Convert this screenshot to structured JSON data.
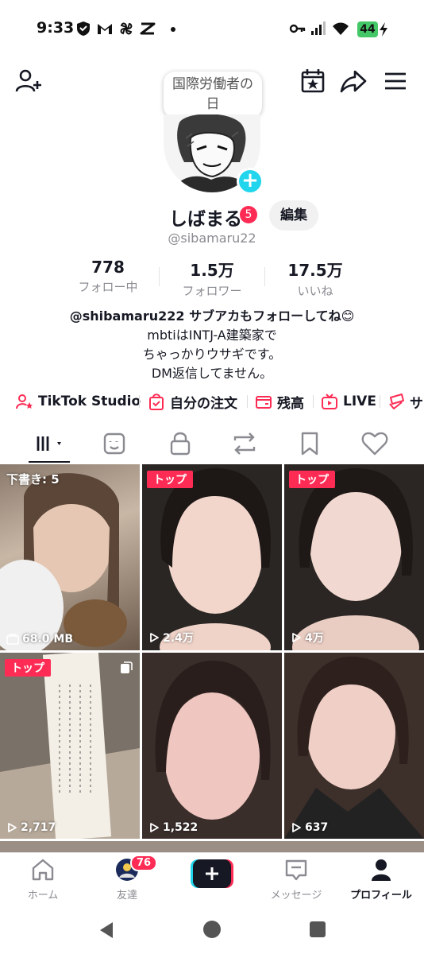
{
  "status_bar": {
    "time": "9:33",
    "battery": "44"
  },
  "header": {
    "event_bubble": "国際労働者の日"
  },
  "profile": {
    "username": "しばまる",
    "badge_count": "5",
    "edit_label": "編集",
    "handle": "@sibamaru22",
    "stats": [
      {
        "value": "778",
        "label": "フォロー中"
      },
      {
        "value": "1.5万",
        "label": "フォロワー"
      },
      {
        "value": "17.5万",
        "label": "いいね"
      }
    ],
    "bio_lines": [
      "@shibamaru222  サブアカもフォローしてね😊",
      "mbtiはINTJ-A建築家で",
      "ちゃっかりウサギです。",
      "DM返信してません。"
    ]
  },
  "shortcuts": [
    {
      "label": "TikTok Studio",
      "icon": "person-star-icon"
    },
    {
      "label": "自分の注文",
      "icon": "bag-check-icon"
    },
    {
      "label": "残高",
      "icon": "wallet-icon"
    },
    {
      "label": "LIVE",
      "icon": "live-tv-icon"
    },
    {
      "label": "サ",
      "icon": "gift-icon"
    }
  ],
  "grid": [
    {
      "badge": "",
      "draft": "下書き: 5",
      "meta": "68.0 MB",
      "meta_icon": "storage-icon"
    },
    {
      "badge": "トップ",
      "draft": "",
      "meta": "2.4万",
      "meta_icon": "play-icon"
    },
    {
      "badge": "トップ",
      "draft": "",
      "meta": "4万",
      "meta_icon": "play-icon"
    },
    {
      "badge": "トップ",
      "draft": "",
      "meta": "2,717",
      "meta_icon": "play-icon"
    },
    {
      "badge": "",
      "draft": "",
      "meta": "1,522",
      "meta_icon": "play-icon"
    },
    {
      "badge": "",
      "draft": "",
      "meta": "637",
      "meta_icon": "play-icon"
    }
  ],
  "bottom_nav": {
    "home": "ホーム",
    "friends": "友達",
    "friends_badge": "76",
    "inbox": "メッセージ",
    "profile": "プロフィール"
  },
  "colors": {
    "accent": "#fe2c55",
    "cyan": "#20d5ec",
    "muted": "#8a8b91"
  }
}
